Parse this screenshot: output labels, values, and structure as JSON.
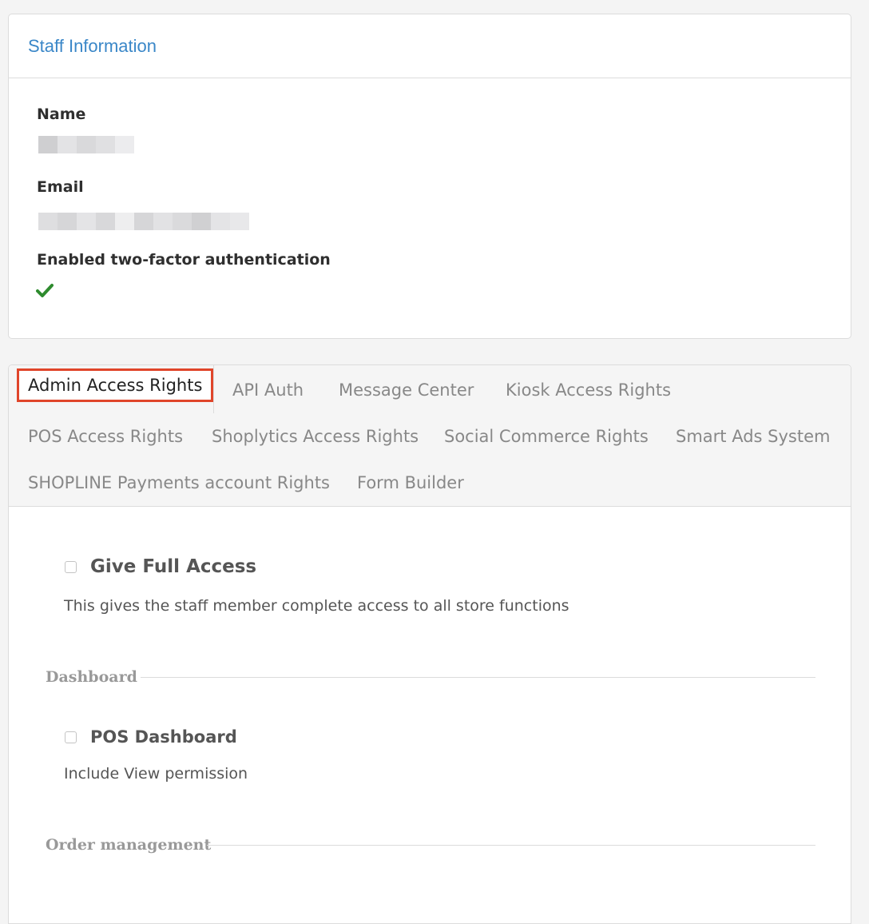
{
  "staff_info": {
    "title": "Staff Information",
    "name_label": "Name",
    "email_label": "Email",
    "twofa_label": "Enabled two-factor authentication",
    "twofa_icon": "check-icon",
    "check_color": "#2e8b2e"
  },
  "tabs": [
    {
      "label": "Admin Access Rights",
      "active": true
    },
    {
      "label": "API Auth",
      "active": false
    },
    {
      "label": "Message Center",
      "active": false
    },
    {
      "label": "Kiosk Access Rights",
      "active": false
    },
    {
      "label": "POS Access Rights",
      "active": false
    },
    {
      "label": "Shoplytics Access Rights",
      "active": false
    },
    {
      "label": "Social Commerce Rights",
      "active": false
    },
    {
      "label": "Smart Ads System",
      "active": false
    },
    {
      "label": "SHOPLINE Payments account Rights",
      "active": false
    },
    {
      "label": "Form Builder",
      "active": false
    }
  ],
  "full_access": {
    "label": "Give Full Access",
    "description": "This gives the staff member complete access to all store functions",
    "checked": false
  },
  "sections": [
    {
      "title": "Dashboard",
      "options": [
        {
          "label": "POS Dashboard",
          "description": "Include View permission",
          "checked": false
        }
      ]
    },
    {
      "title": "Order management",
      "options": []
    }
  ],
  "colors": {
    "accent": "#3a87c8",
    "active_tab_border": "#e0452a"
  }
}
